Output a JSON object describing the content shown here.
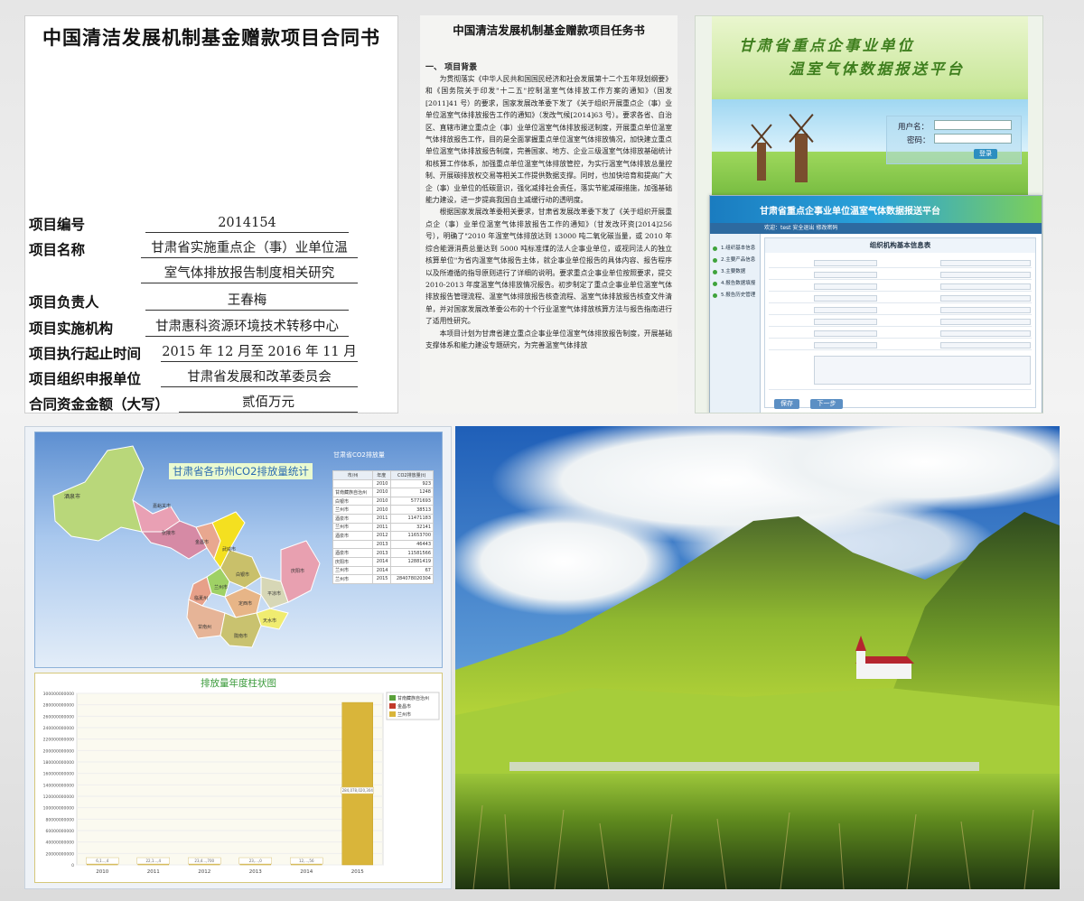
{
  "contract": {
    "title": "中国清洁发展机制基金赠款项目合同书",
    "fields": [
      {
        "label": "项目编号",
        "value": "2014154"
      },
      {
        "label": "项目名称",
        "value": "甘肃省实施重点企（事）业单位温",
        "value2": "室气体排放报告制度相关研究"
      },
      {
        "label": "项目负责人",
        "value": "王春梅"
      },
      {
        "label": "项目实施机构",
        "value": "甘肃惠科资源环境技术转移中心"
      },
      {
        "label": "项目执行起止时间",
        "value": "2015 年 12 月至 2016 年 11 月"
      },
      {
        "label": "项目组织申报单位",
        "value": "甘肃省发展和改革委员会"
      },
      {
        "label": "合同资金金额（大写）",
        "value": "贰佰万元"
      }
    ]
  },
  "taskbook": {
    "title": "中国清洁发展机制基金赠款项目任务书",
    "section": "一、 项目背景",
    "paragraphs": [
      "为贯彻落实《中华人民共和国国民经济和社会发展第十二个五年规划纲要》和《国务院关于印发\"十二五\"控制温室气体排放工作方案的通知》（国发[2011]41 号）的要求，国家发展改革委下发了《关于组织开展重点企（事）业单位温室气体排放报告工作的通知》（发改气候[2014]63 号）。要求各省、自治区、直辖市建立重点企（事）业单位温室气体排放报送制度，开展重点单位温室气体排放报告工作，目的是全面掌握重点单位温室气体排放情况，加快建立重点单位温室气体排放报告制度，完善国家、地方、企业三级温室气体排放基础统计和核算工作体系，加强重点单位温室气体排放管控，为实行温室气体排放总量控制、开展碳排放权交易等相关工作提供数据支撑。同时，也加快培育和提高广大企（事）业单位的低碳意识，强化减排社会责任，落实节能减碳措施，加强基础能力建设，进一步提高我国自主减缓行动的透明度。",
      "根据国家发展改革委相关要求，甘肃省发展改革委下发了《关于组织开展重点企（事）业单位温室气体排放报告工作的通知》（甘发改环资[2014]256 号），明确了\"2010 年温室气体排放达到 13000 吨二氧化碳当量，或 2010 年综合能源消费总量达到 5000 吨标准煤的法人企事业单位，或视同法人的独立核算单位\"为省内温室气体报告主体，就企事业单位报告的具体内容、报告程序以及所遵循的指导原则进行了详细的说明。要求重点企事业单位按照要求，提交 2010-2013 年度温室气体排放情况报告。初步制定了重点企事业单位温室气体排放报告管理流程、温室气体排放报告核查流程、温室气体排放报告核查文件清单，并对国家发展改革委公布的十个行业温室气体排放核算方法与报告指南进行了适用性研究。",
      "本项目计划为甘肃省建立重点企事业单位温室气体排放报告制度，开展基础支撑体系和能力建设专题研究，为完善温室气体排放"
    ]
  },
  "platform": {
    "title_line1": "甘肃省重点企事业单位",
    "title_line2": "温室气体数据报送平台",
    "username_label": "用户名：",
    "password_label": "密码：",
    "login_button": "登录",
    "system_header": "甘肃省重点企事业单位温室气体数据报送平台",
    "system_bar": "欢迎：test 安全退出 修改密码",
    "form_title": "组织机构基本信息表",
    "menu_items": [
      "1.组织基本信息",
      "2.主要产品信息",
      "3.主要数据",
      "4.报告数据填报",
      "5.报告历史管理"
    ],
    "next_button": "下一步",
    "save_button": "保存"
  },
  "map": {
    "title": "甘肃省各市州CO2排放量统计",
    "table_title": "甘肃省CO2排放量",
    "columns": [
      "市/州",
      "年度",
      "CO2排放量(t)"
    ],
    "rows": [
      [
        "",
        "2010",
        "923"
      ],
      [
        "甘南藏族自治州",
        "2010",
        "1248"
      ],
      [
        "白银市",
        "2010",
        "5771693"
      ],
      [
        "兰州市",
        "2010",
        "38513"
      ],
      [
        "酒泉市",
        "2011",
        "11471183"
      ],
      [
        "兰州市",
        "2011",
        "32141"
      ],
      [
        "酒泉市",
        "2012",
        "11653700"
      ],
      [
        "",
        "2013",
        "46443"
      ],
      [
        "酒泉市",
        "2013",
        "11581566"
      ],
      [
        "庆阳市",
        "2014",
        "12881419"
      ],
      [
        "兰州市",
        "2014",
        "67"
      ],
      [
        "兰州市",
        "2015",
        "284078020304"
      ]
    ],
    "city_labels": [
      "酒泉市",
      "嘉峪关市",
      "张掖市",
      "金昌市",
      "武威市",
      "白银市",
      "兰州市",
      "临夏州",
      "定西市",
      "平凉市",
      "庆阳市",
      "天水市",
      "甘南州",
      "陇南市"
    ]
  },
  "chart_data": {
    "type": "bar",
    "title": "排放量年度柱状图",
    "categories": [
      "2010",
      "2011",
      "2012",
      "2013",
      "2014",
      "2015"
    ],
    "series": [
      {
        "name": "甘南藏族自治州",
        "values": [
          1248,
          0,
          0,
          0,
          0,
          0
        ]
      },
      {
        "name": "金昌市",
        "values": [
          0,
          0,
          0,
          0,
          0,
          0
        ]
      },
      {
        "name": "兰州市",
        "values": [
          38513,
          32141,
          0,
          0,
          67,
          284078020304
        ]
      }
    ],
    "bar_labels": [
      "6,1...,4",
      "22,1...,4",
      "23,4...,700",
      "23,...,0",
      "12,...,56",
      "284,078,020,304"
    ],
    "yticks": [
      "0",
      "20000000000",
      "40000000000",
      "60000000000",
      "80000000000",
      "100000000000",
      "120000000000",
      "140000000000",
      "160000000000",
      "180000000000",
      "200000000000",
      "220000000000",
      "240000000000",
      "260000000000",
      "280000000000",
      "300000000000"
    ],
    "ylim": [
      0,
      300000000000
    ],
    "colors": {
      "甘南藏族自治州": "#5aa13a",
      "金昌市": "#c23a2a",
      "兰州市": "#d9b53a"
    },
    "legend": "top-right",
    "grid": true
  }
}
